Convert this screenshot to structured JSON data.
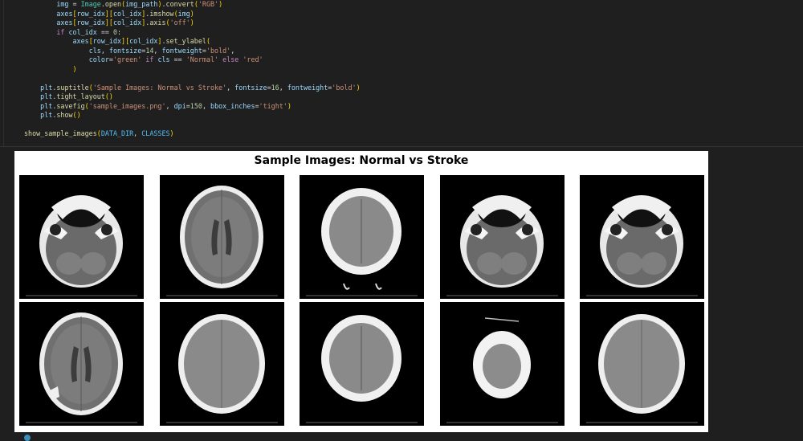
{
  "code_lines": [
    [
      [
        "        ",
        "op"
      ],
      [
        "img",
        "var"
      ],
      [
        " = ",
        "op"
      ],
      [
        "Image",
        "cls"
      ],
      [
        ".",
        "op"
      ],
      [
        "open",
        "fn"
      ],
      [
        "(",
        "brk"
      ],
      [
        "img_path",
        "var"
      ],
      [
        ")",
        "brk"
      ],
      [
        ".",
        "op"
      ],
      [
        "convert",
        "fn"
      ],
      [
        "(",
        "brk"
      ],
      [
        "'RGB'",
        "str"
      ],
      [
        ")",
        "brk"
      ]
    ],
    [
      [
        "        ",
        "op"
      ],
      [
        "axes",
        "var"
      ],
      [
        "[",
        "brk"
      ],
      [
        "row_idx",
        "var"
      ],
      [
        "]",
        "brk"
      ],
      [
        "[",
        "brk"
      ],
      [
        "col_idx",
        "var"
      ],
      [
        "]",
        "brk"
      ],
      [
        ".",
        "op"
      ],
      [
        "imshow",
        "fn"
      ],
      [
        "(",
        "brk"
      ],
      [
        "img",
        "var"
      ],
      [
        ")",
        "brk"
      ]
    ],
    [
      [
        "        ",
        "op"
      ],
      [
        "axes",
        "var"
      ],
      [
        "[",
        "brk"
      ],
      [
        "row_idx",
        "var"
      ],
      [
        "]",
        "brk"
      ],
      [
        "[",
        "brk"
      ],
      [
        "col_idx",
        "var"
      ],
      [
        "]",
        "brk"
      ],
      [
        ".",
        "op"
      ],
      [
        "axis",
        "fn"
      ],
      [
        "(",
        "brk"
      ],
      [
        "'off'",
        "str"
      ],
      [
        ")",
        "brk"
      ]
    ],
    [
      [
        "        ",
        "op"
      ],
      [
        "if",
        "kw"
      ],
      [
        " ",
        "op"
      ],
      [
        "col_idx",
        "var"
      ],
      [
        " == ",
        "op"
      ],
      [
        "0",
        "num"
      ],
      [
        ":",
        "op"
      ]
    ],
    [
      [
        "            ",
        "op"
      ],
      [
        "axes",
        "var"
      ],
      [
        "[",
        "brk"
      ],
      [
        "row_idx",
        "var"
      ],
      [
        "]",
        "brk"
      ],
      [
        "[",
        "brk"
      ],
      [
        "col_idx",
        "var"
      ],
      [
        "]",
        "brk"
      ],
      [
        ".",
        "op"
      ],
      [
        "set_ylabel",
        "fn"
      ],
      [
        "(",
        "brk"
      ]
    ],
    [
      [
        "                ",
        "op"
      ],
      [
        "cls",
        "var"
      ],
      [
        ", ",
        "op"
      ],
      [
        "fontsize",
        "kwarg"
      ],
      [
        "=",
        "op"
      ],
      [
        "14",
        "num"
      ],
      [
        ", ",
        "op"
      ],
      [
        "fontweight",
        "kwarg"
      ],
      [
        "=",
        "op"
      ],
      [
        "'bold'",
        "str"
      ],
      [
        ",",
        "op"
      ]
    ],
    [
      [
        "                ",
        "op"
      ],
      [
        "color",
        "kwarg"
      ],
      [
        "=",
        "op"
      ],
      [
        "'green'",
        "str"
      ],
      [
        " ",
        "op"
      ],
      [
        "if",
        "kw"
      ],
      [
        " ",
        "op"
      ],
      [
        "cls",
        "var"
      ],
      [
        " == ",
        "op"
      ],
      [
        "'Normal'",
        "str"
      ],
      [
        " ",
        "op"
      ],
      [
        "else",
        "kw"
      ],
      [
        " ",
        "op"
      ],
      [
        "'red'",
        "str"
      ]
    ],
    [
      [
        "            ",
        "op"
      ],
      [
        ")",
        "brk"
      ]
    ],
    [
      [
        "",
        "op"
      ]
    ],
    [
      [
        "    ",
        "op"
      ],
      [
        "plt",
        "var"
      ],
      [
        ".",
        "op"
      ],
      [
        "suptitle",
        "fn"
      ],
      [
        "(",
        "brk"
      ],
      [
        "'Sample Images: Normal vs Stroke'",
        "str"
      ],
      [
        ", ",
        "op"
      ],
      [
        "fontsize",
        "kwarg"
      ],
      [
        "=",
        "op"
      ],
      [
        "16",
        "num"
      ],
      [
        ", ",
        "op"
      ],
      [
        "fontweight",
        "kwarg"
      ],
      [
        "=",
        "op"
      ],
      [
        "'bold'",
        "str"
      ],
      [
        ")",
        "brk"
      ]
    ],
    [
      [
        "    ",
        "op"
      ],
      [
        "plt",
        "var"
      ],
      [
        ".",
        "op"
      ],
      [
        "tight_layout",
        "fn"
      ],
      [
        "()",
        "brk"
      ]
    ],
    [
      [
        "    ",
        "op"
      ],
      [
        "plt",
        "var"
      ],
      [
        ".",
        "op"
      ],
      [
        "savefig",
        "fn"
      ],
      [
        "(",
        "brk"
      ],
      [
        "'sample_images.png'",
        "str"
      ],
      [
        ", ",
        "op"
      ],
      [
        "dpi",
        "kwarg"
      ],
      [
        "=",
        "op"
      ],
      [
        "150",
        "num"
      ],
      [
        ", ",
        "op"
      ],
      [
        "bbox_inches",
        "kwarg"
      ],
      [
        "=",
        "op"
      ],
      [
        "'tight'",
        "str"
      ],
      [
        ")",
        "brk"
      ]
    ],
    [
      [
        "    ",
        "op"
      ],
      [
        "plt",
        "var"
      ],
      [
        ".",
        "op"
      ],
      [
        "show",
        "fn"
      ],
      [
        "()",
        "brk"
      ]
    ],
    [
      [
        "",
        "op"
      ]
    ],
    [
      [
        "show_sample_images",
        "fn"
      ],
      [
        "(",
        "brk"
      ],
      [
        "DATA_DIR",
        "const"
      ],
      [
        ", ",
        "op"
      ],
      [
        "CLASSES",
        "const"
      ],
      [
        ")",
        "brk"
      ]
    ]
  ],
  "figure": {
    "title": "Sample Images: Normal vs Stroke"
  },
  "tiles": [
    {
      "row": 0,
      "col": 0,
      "kind": "base-skull"
    },
    {
      "row": 0,
      "col": 1,
      "kind": "axial-ventricles"
    },
    {
      "row": 0,
      "col": 2,
      "kind": "high-vertex"
    },
    {
      "row": 0,
      "col": 3,
      "kind": "base-skull"
    },
    {
      "row": 0,
      "col": 4,
      "kind": "base-skull"
    },
    {
      "row": 1,
      "col": 0,
      "kind": "axial-ventricles"
    },
    {
      "row": 1,
      "col": 1,
      "kind": "axial-mid"
    },
    {
      "row": 1,
      "col": 2,
      "kind": "high-vertex"
    },
    {
      "row": 1,
      "col": 3,
      "kind": "small-vertex"
    },
    {
      "row": 1,
      "col": 4,
      "kind": "axial-mid"
    }
  ]
}
